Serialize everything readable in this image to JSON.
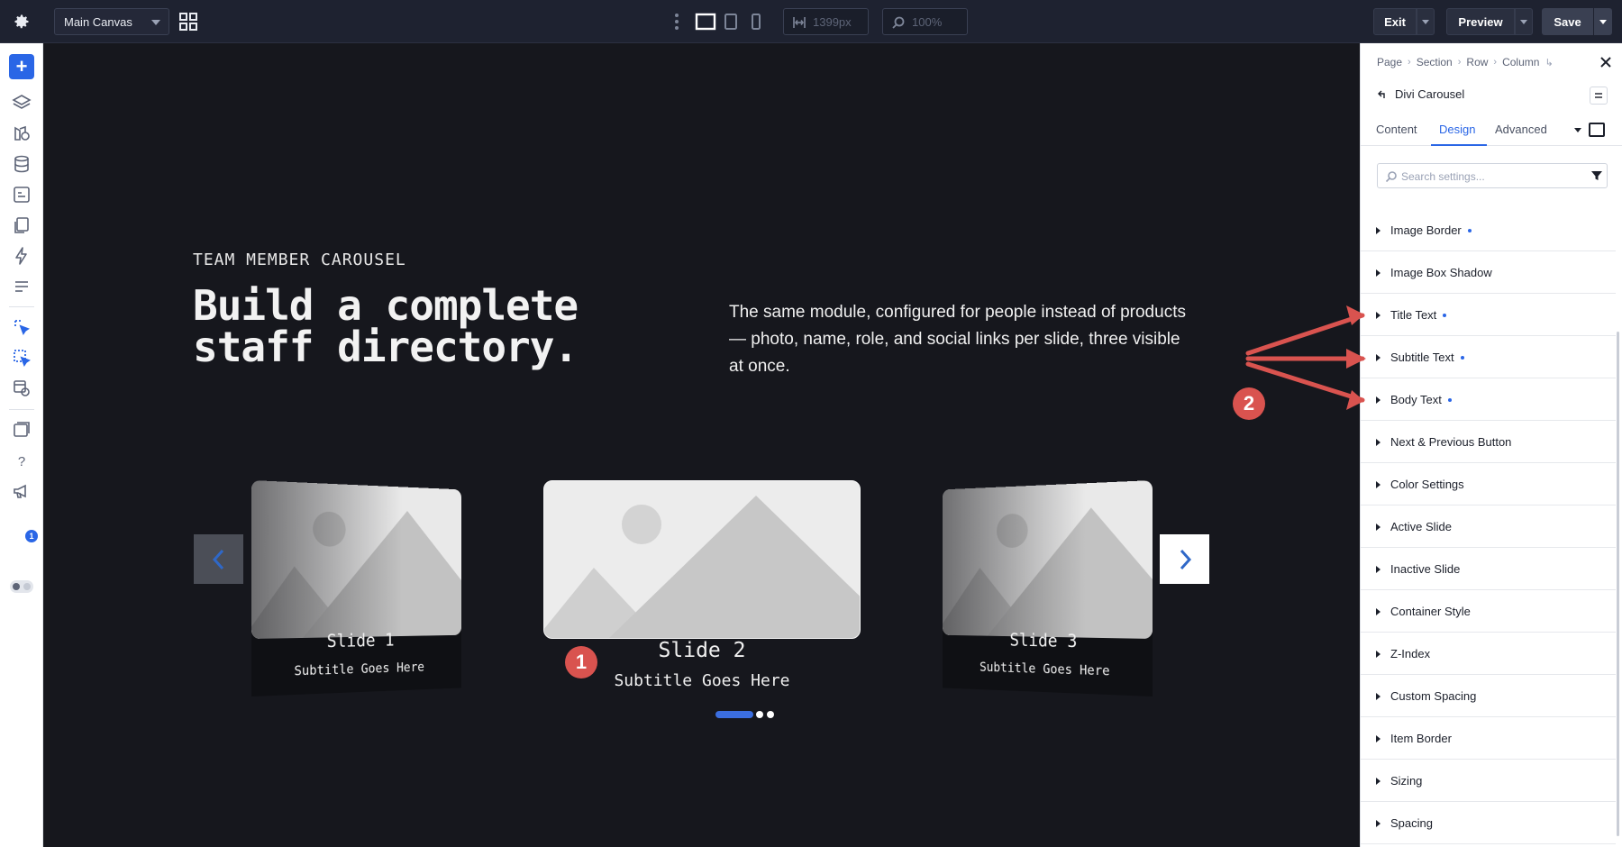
{
  "toolbar": {
    "canvas_select": "Main Canvas",
    "width_value": "1399px",
    "zoom_value": "100%",
    "exit_label": "Exit",
    "preview_label": "Preview",
    "save_label": "Save"
  },
  "leftbar": {
    "notification_count": "1"
  },
  "canvas": {
    "eyebrow": "TEAM MEMBER CAROUSEL",
    "headline": "Build a complete staff directory.",
    "intro": "The same module, configured for people instead of products — photo, name, role, and social links per slide, three visible at once.",
    "slides": [
      {
        "title": "Slide 1",
        "subtitle": "Subtitle Goes Here"
      },
      {
        "title": "Slide 2",
        "subtitle": "Subtitle Goes Here"
      },
      {
        "title": "Slide 3",
        "subtitle": "Subtitle Goes Here"
      }
    ],
    "active_slide": 2,
    "markers": [
      "1",
      "2"
    ]
  },
  "panel": {
    "breadcrumbs": [
      "Page",
      "Section",
      "Row",
      "Column"
    ],
    "module_name": "Divi Carousel",
    "tabs": [
      "Content",
      "Design",
      "Advanced"
    ],
    "active_tab": "Design",
    "search_placeholder": "Search settings...",
    "groups": [
      {
        "label": "Image Border",
        "modified": true
      },
      {
        "label": "Image Box Shadow",
        "modified": false
      },
      {
        "label": "Title Text",
        "modified": true
      },
      {
        "label": "Subtitle Text",
        "modified": true
      },
      {
        "label": "Body Text",
        "modified": true
      },
      {
        "label": "Next & Previous Button",
        "modified": false
      },
      {
        "label": "Color Settings",
        "modified": false
      },
      {
        "label": "Active Slide",
        "modified": false
      },
      {
        "label": "Inactive Slide",
        "modified": false
      },
      {
        "label": "Container Style",
        "modified": false
      },
      {
        "label": "Z-Index",
        "modified": false
      },
      {
        "label": "Custom Spacing",
        "modified": false
      },
      {
        "label": "Item Border",
        "modified": false
      },
      {
        "label": "Sizing",
        "modified": false
      },
      {
        "label": "Spacing",
        "modified": false
      }
    ]
  },
  "colors": {
    "accent": "#2a66e6",
    "marker": "#d9534f",
    "canvas_bg": "#16171d"
  }
}
